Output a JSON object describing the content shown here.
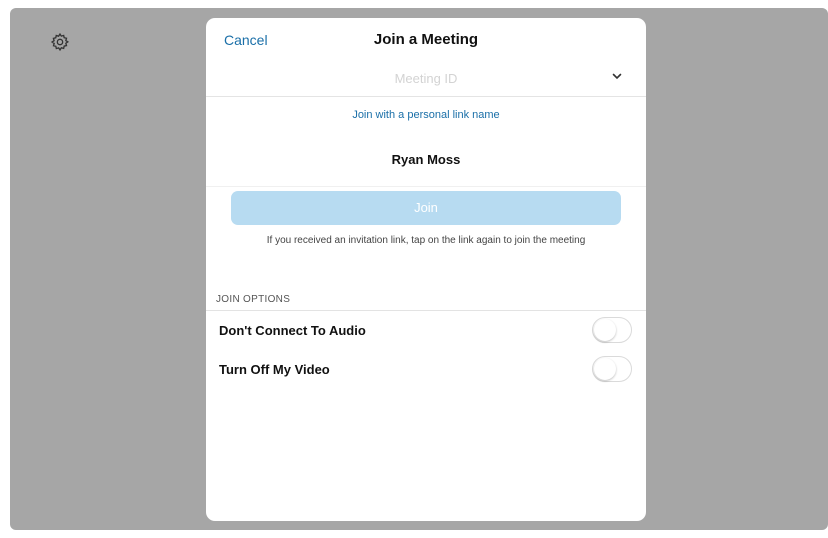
{
  "background": {
    "color": "#a6a6a6"
  },
  "settings": {
    "icon": "gear-icon"
  },
  "dialog": {
    "cancel_label": "Cancel",
    "title": "Join a Meeting",
    "meeting_id": {
      "placeholder": "Meeting ID",
      "value": ""
    },
    "personal_link_label": "Join with a personal link name",
    "name_value": "Ryan Moss",
    "join_label": "Join",
    "hint_text": "If you received an invitation link, tap on the link again to join the meeting",
    "options_header": "JOIN OPTIONS",
    "options": [
      {
        "label": "Don't Connect To Audio",
        "enabled": false
      },
      {
        "label": "Turn Off My Video",
        "enabled": false
      }
    ]
  },
  "colors": {
    "accent": "#1a6fa8",
    "join_button_disabled": "#b7dbf1"
  }
}
